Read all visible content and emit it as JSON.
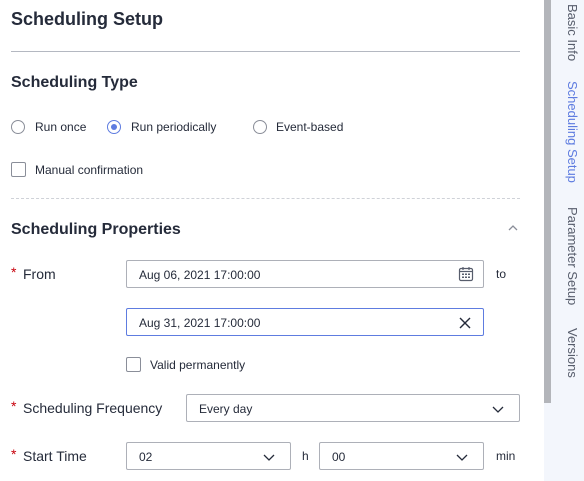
{
  "page": {
    "title": "Scheduling Setup"
  },
  "scheduling_type": {
    "title": "Scheduling Type",
    "options": [
      {
        "label": "Run once",
        "selected": false
      },
      {
        "label": "Run periodically",
        "selected": true
      },
      {
        "label": "Event-based",
        "selected": false
      }
    ],
    "manual_confirmation": {
      "label": "Manual confirmation",
      "checked": false
    }
  },
  "scheduling_properties": {
    "title": "Scheduling Properties",
    "required_mark": "*",
    "from": {
      "label": "From",
      "start_value": "Aug 06, 2021 17:00:00",
      "to_label": "to",
      "end_value": "Aug 31, 2021 17:00:00",
      "valid_permanently": {
        "label": "Valid permanently",
        "checked": false
      }
    },
    "frequency": {
      "label": "Scheduling Frequency",
      "value": "Every day"
    },
    "start_time": {
      "label": "Start Time",
      "hour": "02",
      "hour_unit": "h",
      "minute": "00",
      "minute_unit": "min"
    }
  },
  "sidebar": {
    "tabs": [
      {
        "label": "Basic Info",
        "active": false
      },
      {
        "label": "Scheduling Setup",
        "active": true
      },
      {
        "label": "Parameter Setup",
        "active": false
      },
      {
        "label": "Versions",
        "active": false
      }
    ]
  },
  "colors": {
    "accent": "#5e7ce0",
    "required": "#c7000b",
    "text": "#252b3a",
    "sidebar_bg": "#f3f6fc",
    "scrollbar": "#b3b5ba"
  },
  "icons": {
    "calendar": "calendar-icon",
    "clear": "close-icon",
    "dropdown": "chevron-down-icon",
    "collapse": "chevron-up-icon"
  }
}
